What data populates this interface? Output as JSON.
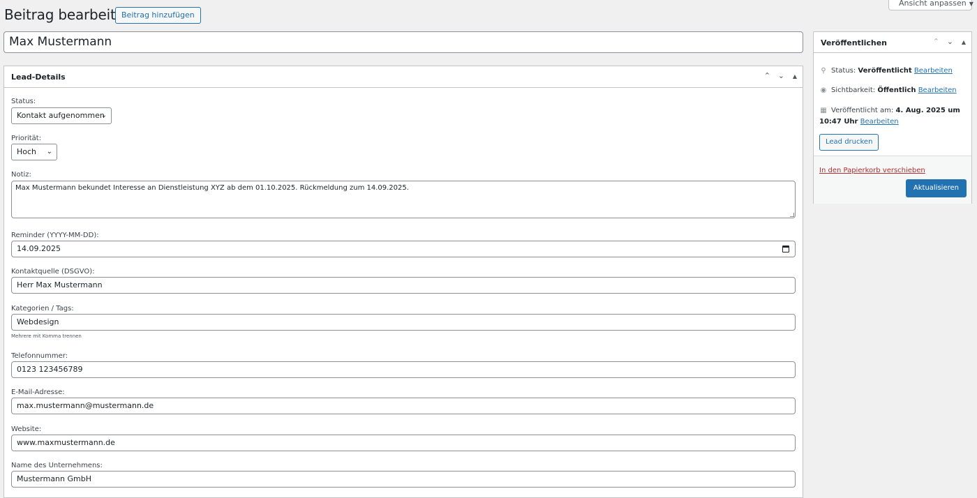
{
  "header": {
    "title": "Beitrag bearbeiten",
    "add_new": "Beitrag hinzufügen",
    "screen_options": "Ansicht anpassen"
  },
  "post_title": "Max Mustermann",
  "lead_box": {
    "title": "Lead-Details",
    "fields": {
      "status": {
        "label": "Status:",
        "value": "Kontakt aufgenommen"
      },
      "priority": {
        "label": "Priorität:",
        "value": "Hoch"
      },
      "note": {
        "label": "Notiz:",
        "value": "Max Mustermann bekundet Interesse an Dienstleistung XYZ ab dem 01.10.2025. Rückmeldung zum 14.09.2025."
      },
      "reminder": {
        "label": "Reminder (YYYY-MM-DD):",
        "value": "14.09.2025"
      },
      "source": {
        "label": "Kontaktquelle (DSGVO):",
        "value": "Herr Max Mustermann"
      },
      "tags": {
        "label": "Kategorien / Tags:",
        "value": "Webdesign",
        "hint": "Mehrere mit Komma trennen"
      },
      "phone": {
        "label": "Telefonnummer:",
        "value": "0123 123456789"
      },
      "email": {
        "label": "E-Mail-Adresse:",
        "value": "max.mustermann@mustermann.de"
      },
      "website": {
        "label": "Website:",
        "value": "www.maxmustermann.de"
      },
      "company": {
        "label": "Name des Unternehmens:",
        "value": "Mustermann GmbH"
      }
    }
  },
  "publish_box": {
    "title": "Veröffentlichen",
    "status_label": "Status:",
    "status_value": "Veröffentlicht",
    "visibility_label": "Sichtbarkeit:",
    "visibility_value": "Öffentlich",
    "published_label": "Veröffentlicht am:",
    "published_value_1": "4. Aug. 2025 um",
    "published_value_2": "10:47 Uhr",
    "edit_link": "Bearbeiten",
    "print_button": "Lead drucken",
    "trash_link": "In den Papierkorb verschieben",
    "update_button": "Aktualisieren"
  },
  "colors": {
    "accent": "#2271b1",
    "danger": "#b32d2e",
    "background": "#f0f0f1"
  },
  "icons": [
    "pin-icon",
    "eye-icon",
    "calendar-icon",
    "chevron-up-icon",
    "chevron-down-icon",
    "toggle-arrow-icon"
  ]
}
